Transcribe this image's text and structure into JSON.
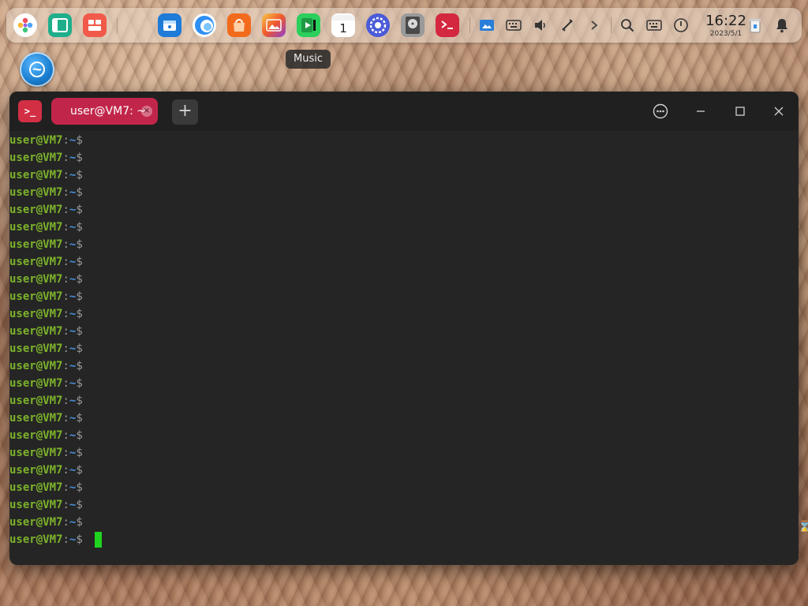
{
  "dock": {
    "apps": [
      {
        "name": "launcher-icon",
        "color": "#ffffff"
      },
      {
        "name": "multitask-icon",
        "color": "#1fae8a"
      },
      {
        "name": "file-manager-icon",
        "color": "#f15a4a"
      },
      {
        "name": "app-store-icon",
        "color": "#1e7bd7"
      },
      {
        "name": "browser-icon",
        "color": "#2f8ff2"
      },
      {
        "name": "app-center-icon",
        "color": "#f26b1d"
      },
      {
        "name": "image-viewer-icon",
        "color": "#f08a24"
      },
      {
        "name": "music-icon",
        "color": "#2bcf5c"
      },
      {
        "name": "calendar-icon",
        "color": "#ffffff"
      },
      {
        "name": "control-center-icon",
        "color": "#4b5bd8"
      },
      {
        "name": "disk-utility-icon",
        "color": "#7a7a7a"
      },
      {
        "name": "terminal-icon",
        "color": "#d3283f"
      }
    ],
    "calendar_day": "1",
    "clock": {
      "time": "16:22",
      "date": "2023/5/1"
    }
  },
  "tooltip": {
    "text": "Music"
  },
  "window": {
    "tab_title": "user@VM7: ~",
    "tab_close": "×",
    "new_tab": "+",
    "app_icon_text": ">_"
  },
  "terminal": {
    "prompt": {
      "user": "user@VM7",
      "sep": ":",
      "path": "~",
      "dollar": "$"
    },
    "line_count": 24
  },
  "colors": {
    "accent": "#c1264a",
    "prompt_user": "#7cb22b",
    "cursor": "#1fd31f",
    "terminal_bg": "#252525"
  }
}
